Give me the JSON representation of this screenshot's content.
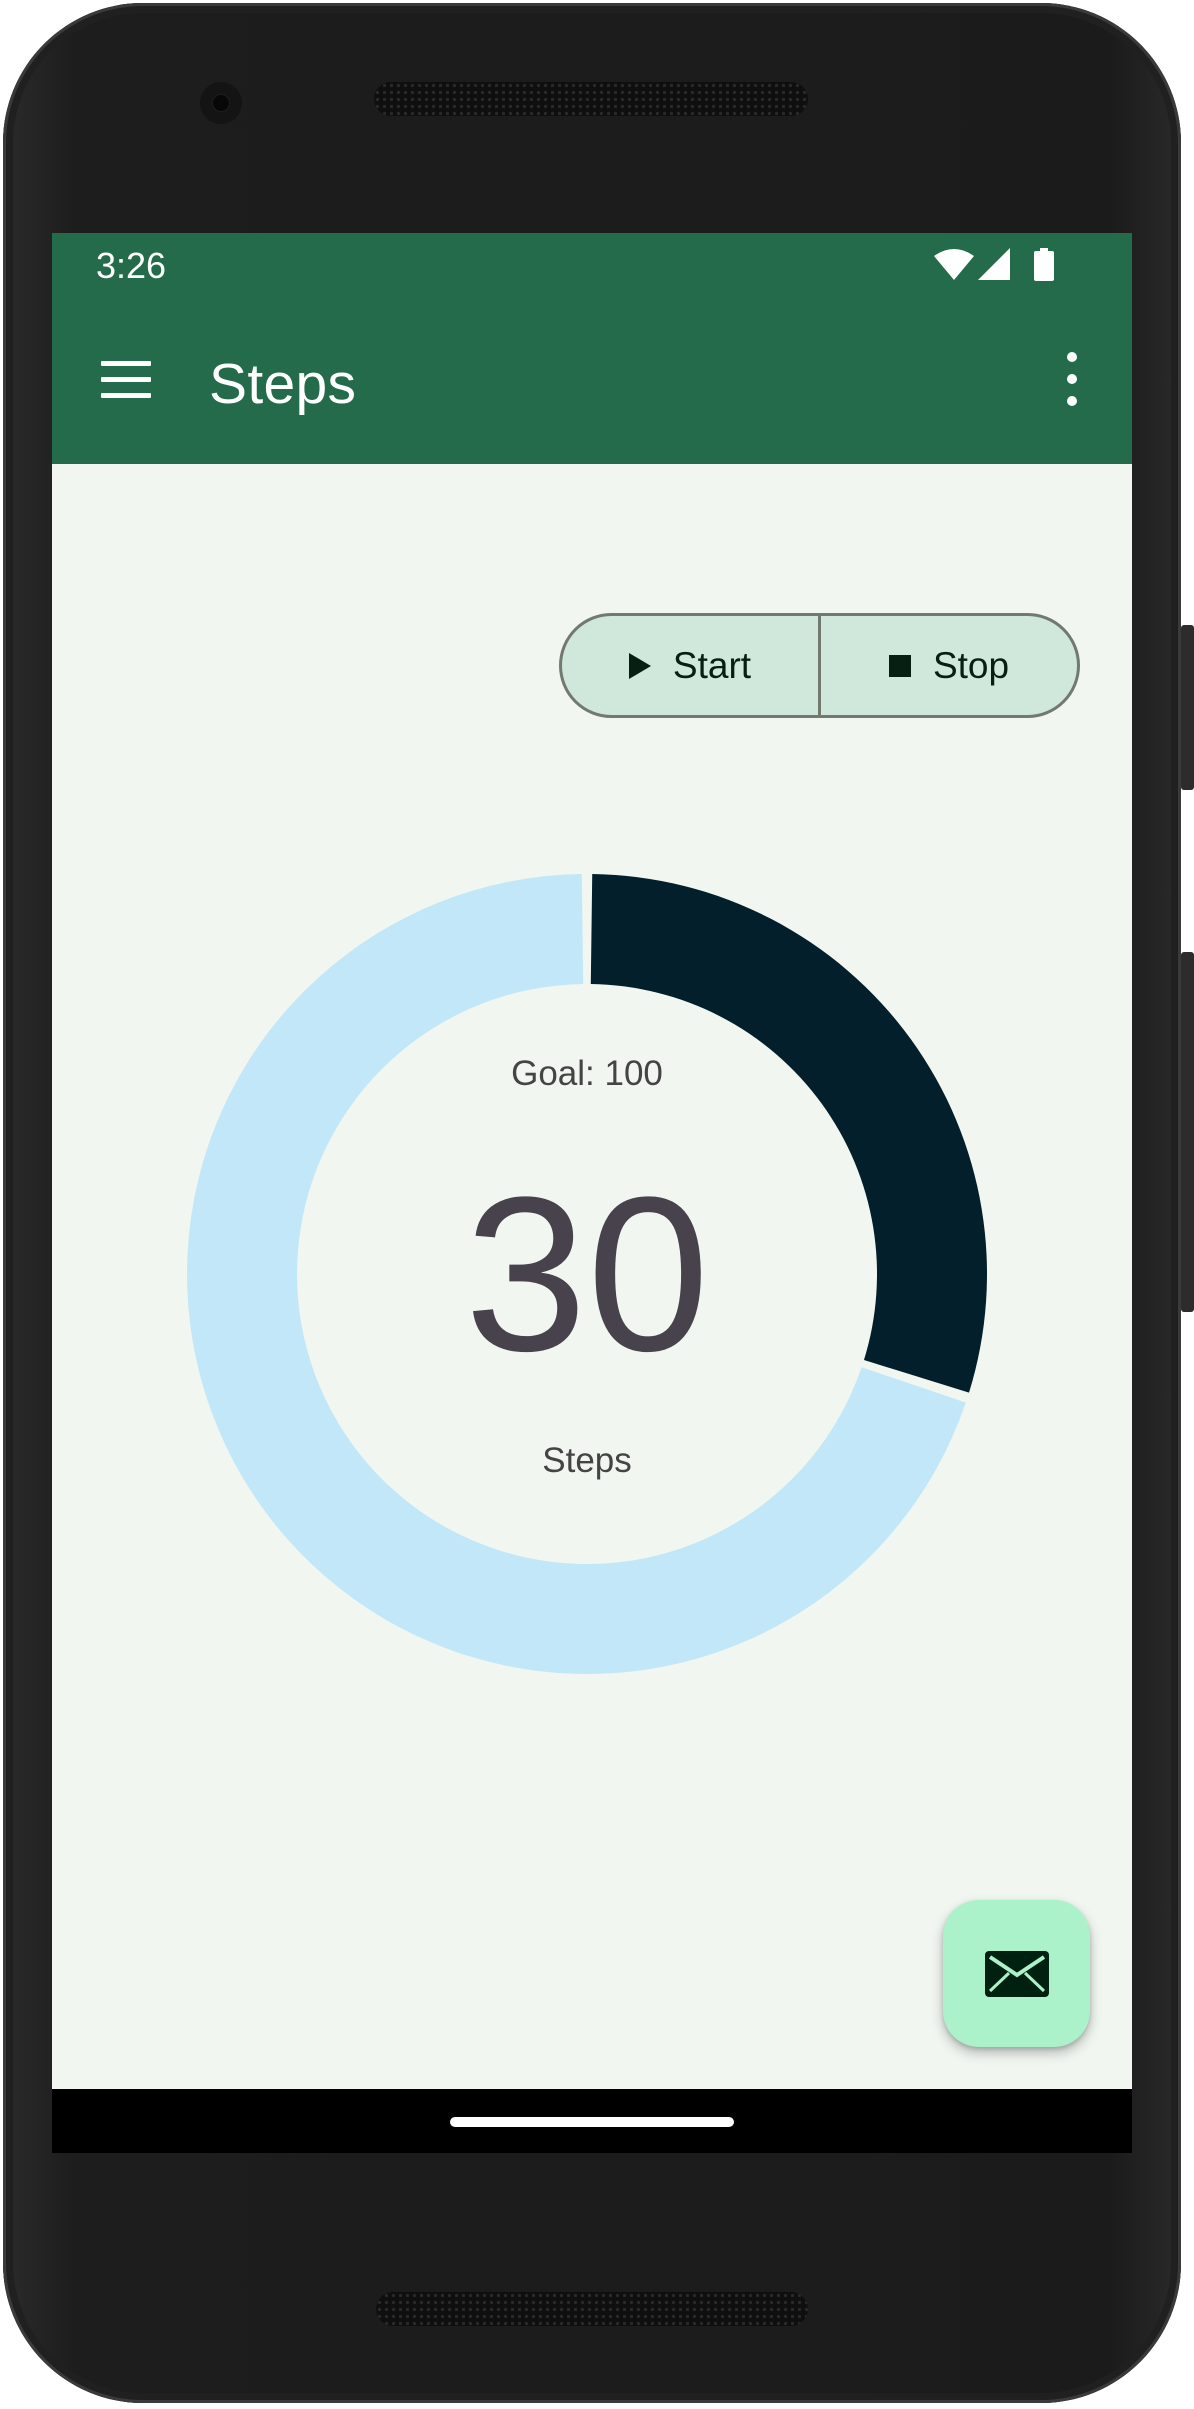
{
  "status_bar": {
    "time": "3:26"
  },
  "app_bar": {
    "title": "Steps"
  },
  "controls": {
    "start_label": "Start",
    "stop_label": "Stop"
  },
  "progress": {
    "goal_label": "Goal: 100",
    "step_count": "30",
    "steps_label": "Steps",
    "fraction": 0.3
  },
  "colors": {
    "app_bar": "#246b4b",
    "background": "#f1f6f1",
    "segment_fill": "#cfe8db",
    "ring_progress": "#021f2b",
    "ring_track": "#c1e7f8",
    "fab": "#abf2cb"
  },
  "icons": {
    "menu": "menu-icon",
    "overflow": "more-vert-icon",
    "start": "play-icon",
    "stop": "stop-icon",
    "fab": "mail-icon",
    "wifi": "wifi-icon",
    "signal": "signal-icon",
    "battery": "battery-icon"
  }
}
